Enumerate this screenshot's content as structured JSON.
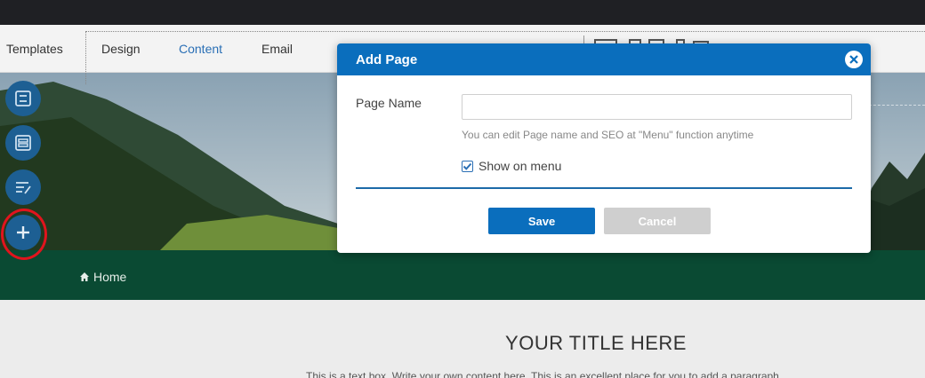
{
  "menu": {
    "items": [
      {
        "label": "Templates",
        "active": false
      },
      {
        "label": "Design",
        "active": false
      },
      {
        "label": "Content",
        "active": true
      },
      {
        "label": "Email",
        "active": false
      }
    ]
  },
  "nav": {
    "home_label": "Home"
  },
  "page": {
    "title": "YOUR TITLE HERE",
    "body_text": "This is a text box. Write your own content here. This is an excellent place for you to add a paragraph"
  },
  "sidebar": {
    "buttons": [
      "form-icon",
      "layout-icon",
      "edit-list-icon",
      "plus-icon"
    ]
  },
  "dialog": {
    "title": "Add Page",
    "page_name_label": "Page Name",
    "page_name_value": "",
    "page_name_placeholder": "",
    "hint": "You can edit Page name and SEO at \"Menu\" function anytime",
    "show_on_menu_label": "Show on menu",
    "show_on_menu_checked": true,
    "save_label": "Save",
    "cancel_label": "Cancel"
  },
  "colors": {
    "accent": "#0a6ebd",
    "nav_green": "#0a4a33",
    "highlight_red": "#e1141d"
  }
}
